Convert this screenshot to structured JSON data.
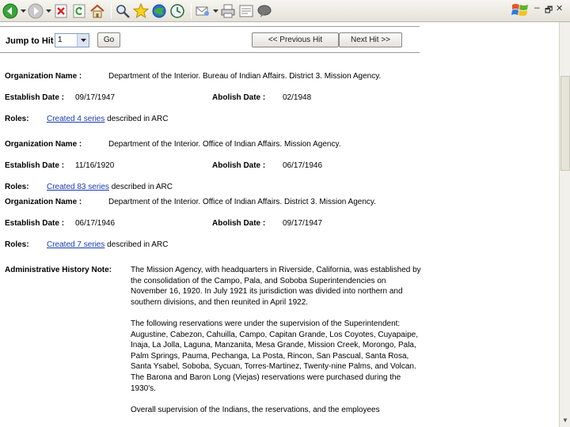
{
  "browser": {
    "toolbar_icons": [
      "back-icon",
      "forward-icon",
      "stop-icon",
      "refresh-icon",
      "home-icon",
      "search-icon",
      "favorites-icon",
      "media-icon",
      "history-icon",
      "mail-icon",
      "print-icon",
      "edit-icon",
      "discuss-icon"
    ],
    "window_controls": {
      "minimize": "–",
      "restore": "🗗",
      "close": "✕"
    }
  },
  "navigation": {
    "jump_label": "Jump to Hit",
    "jump_value": "1",
    "go_label": "Go",
    "prev_label": "<< Previous Hit",
    "next_label": "Next Hit >>"
  },
  "labels": {
    "org_name": "Organization Name :",
    "establish": "Establish Date :",
    "abolish": "Abolish Date :",
    "roles": "Roles:",
    "admin_note": "Administrative History Note:"
  },
  "records": [
    {
      "org_name": "Department of the Interior. Bureau of Indian Affairs. District 3. Mission Agency.",
      "establish_date": "09/17/1947",
      "abolish_date": "02/1948",
      "roles_link": "Created 4 series",
      "roles_suffix": "described in ARC"
    },
    {
      "org_name": "Department of the Interior. Office of Indian Affairs. Mission Agency.",
      "establish_date": "11/16/1920",
      "abolish_date": "06/17/1946",
      "roles_link": "Created 83 series",
      "roles_suffix": "described in ARC"
    },
    {
      "org_name": "Department of the Interior. Office of Indian Affairs. District 3. Mission Agency.",
      "establish_date": "06/17/1946",
      "abolish_date": "09/17/1947",
      "roles_link": "Created 7 series",
      "roles_suffix": "described in ARC"
    }
  ],
  "history_note": [
    "The Mission Agency, with headquarters in Riverside, California, was established by the consolidation of the Campo, Pala, and Soboba Superintendencies on November 16, 1920. In July 1921 its jurisdiction was divided into northern and southern divisions, and then reunited in April 1922.",
    "The following reservations were under the supervision of the Superintendent: Augustine, Cabezon, Cahuilla, Campo, Capitan Grande, Los Coyotes, Cuyapaipe, Inaja, La Jolla, Laguna, Manzanita, Mesa Grande, Mission Creek, Morongo, Pala, Palm Springs, Pauma, Pechanga, La Posta, Rincon, San Pascual, Santa Rosa, Santa Ysabel, Soboba, Sycuan, Torres-Martinez, Twenty-nine Palms, and Volcan. The Barona and Baron Long (Viejas) reservations were purchased during the 1930's.",
    "Overall supervision of the Indians, the reservations, and the employees"
  ],
  "colors": {
    "link": "#1a3bb7",
    "toolbar": "#ece9d8"
  }
}
